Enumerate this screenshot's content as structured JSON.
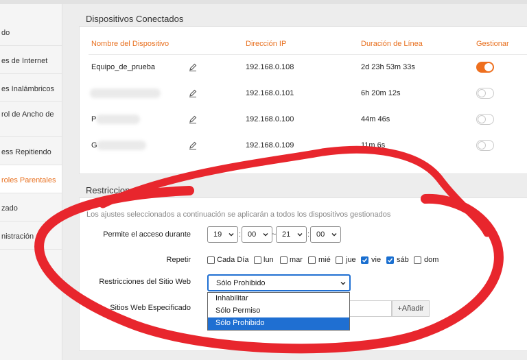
{
  "sidebar": {
    "items": [
      {
        "label": "do",
        "active": false
      },
      {
        "label": "es de Internet",
        "active": false
      },
      {
        "label": "es Inalámbricos",
        "active": false
      },
      {
        "label": "rol de Ancho de",
        "active": false
      },
      {
        "label": "ess Repitiendo",
        "active": false
      },
      {
        "label": "roles Parentales",
        "active": true
      },
      {
        "label": "zado",
        "active": false
      },
      {
        "label": "nistración",
        "active": false
      }
    ]
  },
  "devices": {
    "title": "Dispositivos Conectados",
    "headers": {
      "name": "Nombre del Dispositivo",
      "ip": "Dirección IP",
      "duration": "Duración de Línea",
      "manage": "Gestionar"
    },
    "rows": [
      {
        "name": "Equipo_de_prueba",
        "ip": "192.168.0.108",
        "duration": "2d 23h 53m 33s",
        "managed": true
      },
      {
        "name": "",
        "ip": "192.168.0.101",
        "duration": "6h 20m 12s",
        "managed": false
      },
      {
        "name": "P",
        "ip": "192.168.0.100",
        "duration": "44m 46s",
        "managed": false
      },
      {
        "name": "G",
        "ip": "192.168.0.109",
        "duration": "11m 6s",
        "managed": false
      }
    ]
  },
  "access": {
    "title": "Restricciones de Acceso",
    "note": "Los ajustes seleccionados a continuación se aplicarán a todos los dispositivos gestionados",
    "time_label": "Permite el acceso durante",
    "start_hour": "19",
    "start_min": "00",
    "separator": "~",
    "end_hour": "21",
    "end_min": "00",
    "repeat_label": "Repetir",
    "days": [
      {
        "label": "Cada Día",
        "checked": false
      },
      {
        "label": "lun",
        "checked": false
      },
      {
        "label": "mar",
        "checked": false
      },
      {
        "label": "mié",
        "checked": false
      },
      {
        "label": "jue",
        "checked": false
      },
      {
        "label": "vie",
        "checked": true
      },
      {
        "label": "sáb",
        "checked": true
      },
      {
        "label": "dom",
        "checked": false
      }
    ],
    "site_restrictions_label": "Restricciones del Sitio Web",
    "site_restrictions_value": "Sólo Prohibido",
    "site_restrictions_options": [
      "Inhabilitar",
      "Sólo Permiso",
      "Sólo Prohibido"
    ],
    "websites_label": "Sitios Web Especificado",
    "add_button": "+Añadir"
  },
  "colors": {
    "accent": "#e8701f",
    "toggle_on": "#ee6f1e",
    "highlight": "#1f6fd2",
    "annotation": "#e8262d"
  }
}
